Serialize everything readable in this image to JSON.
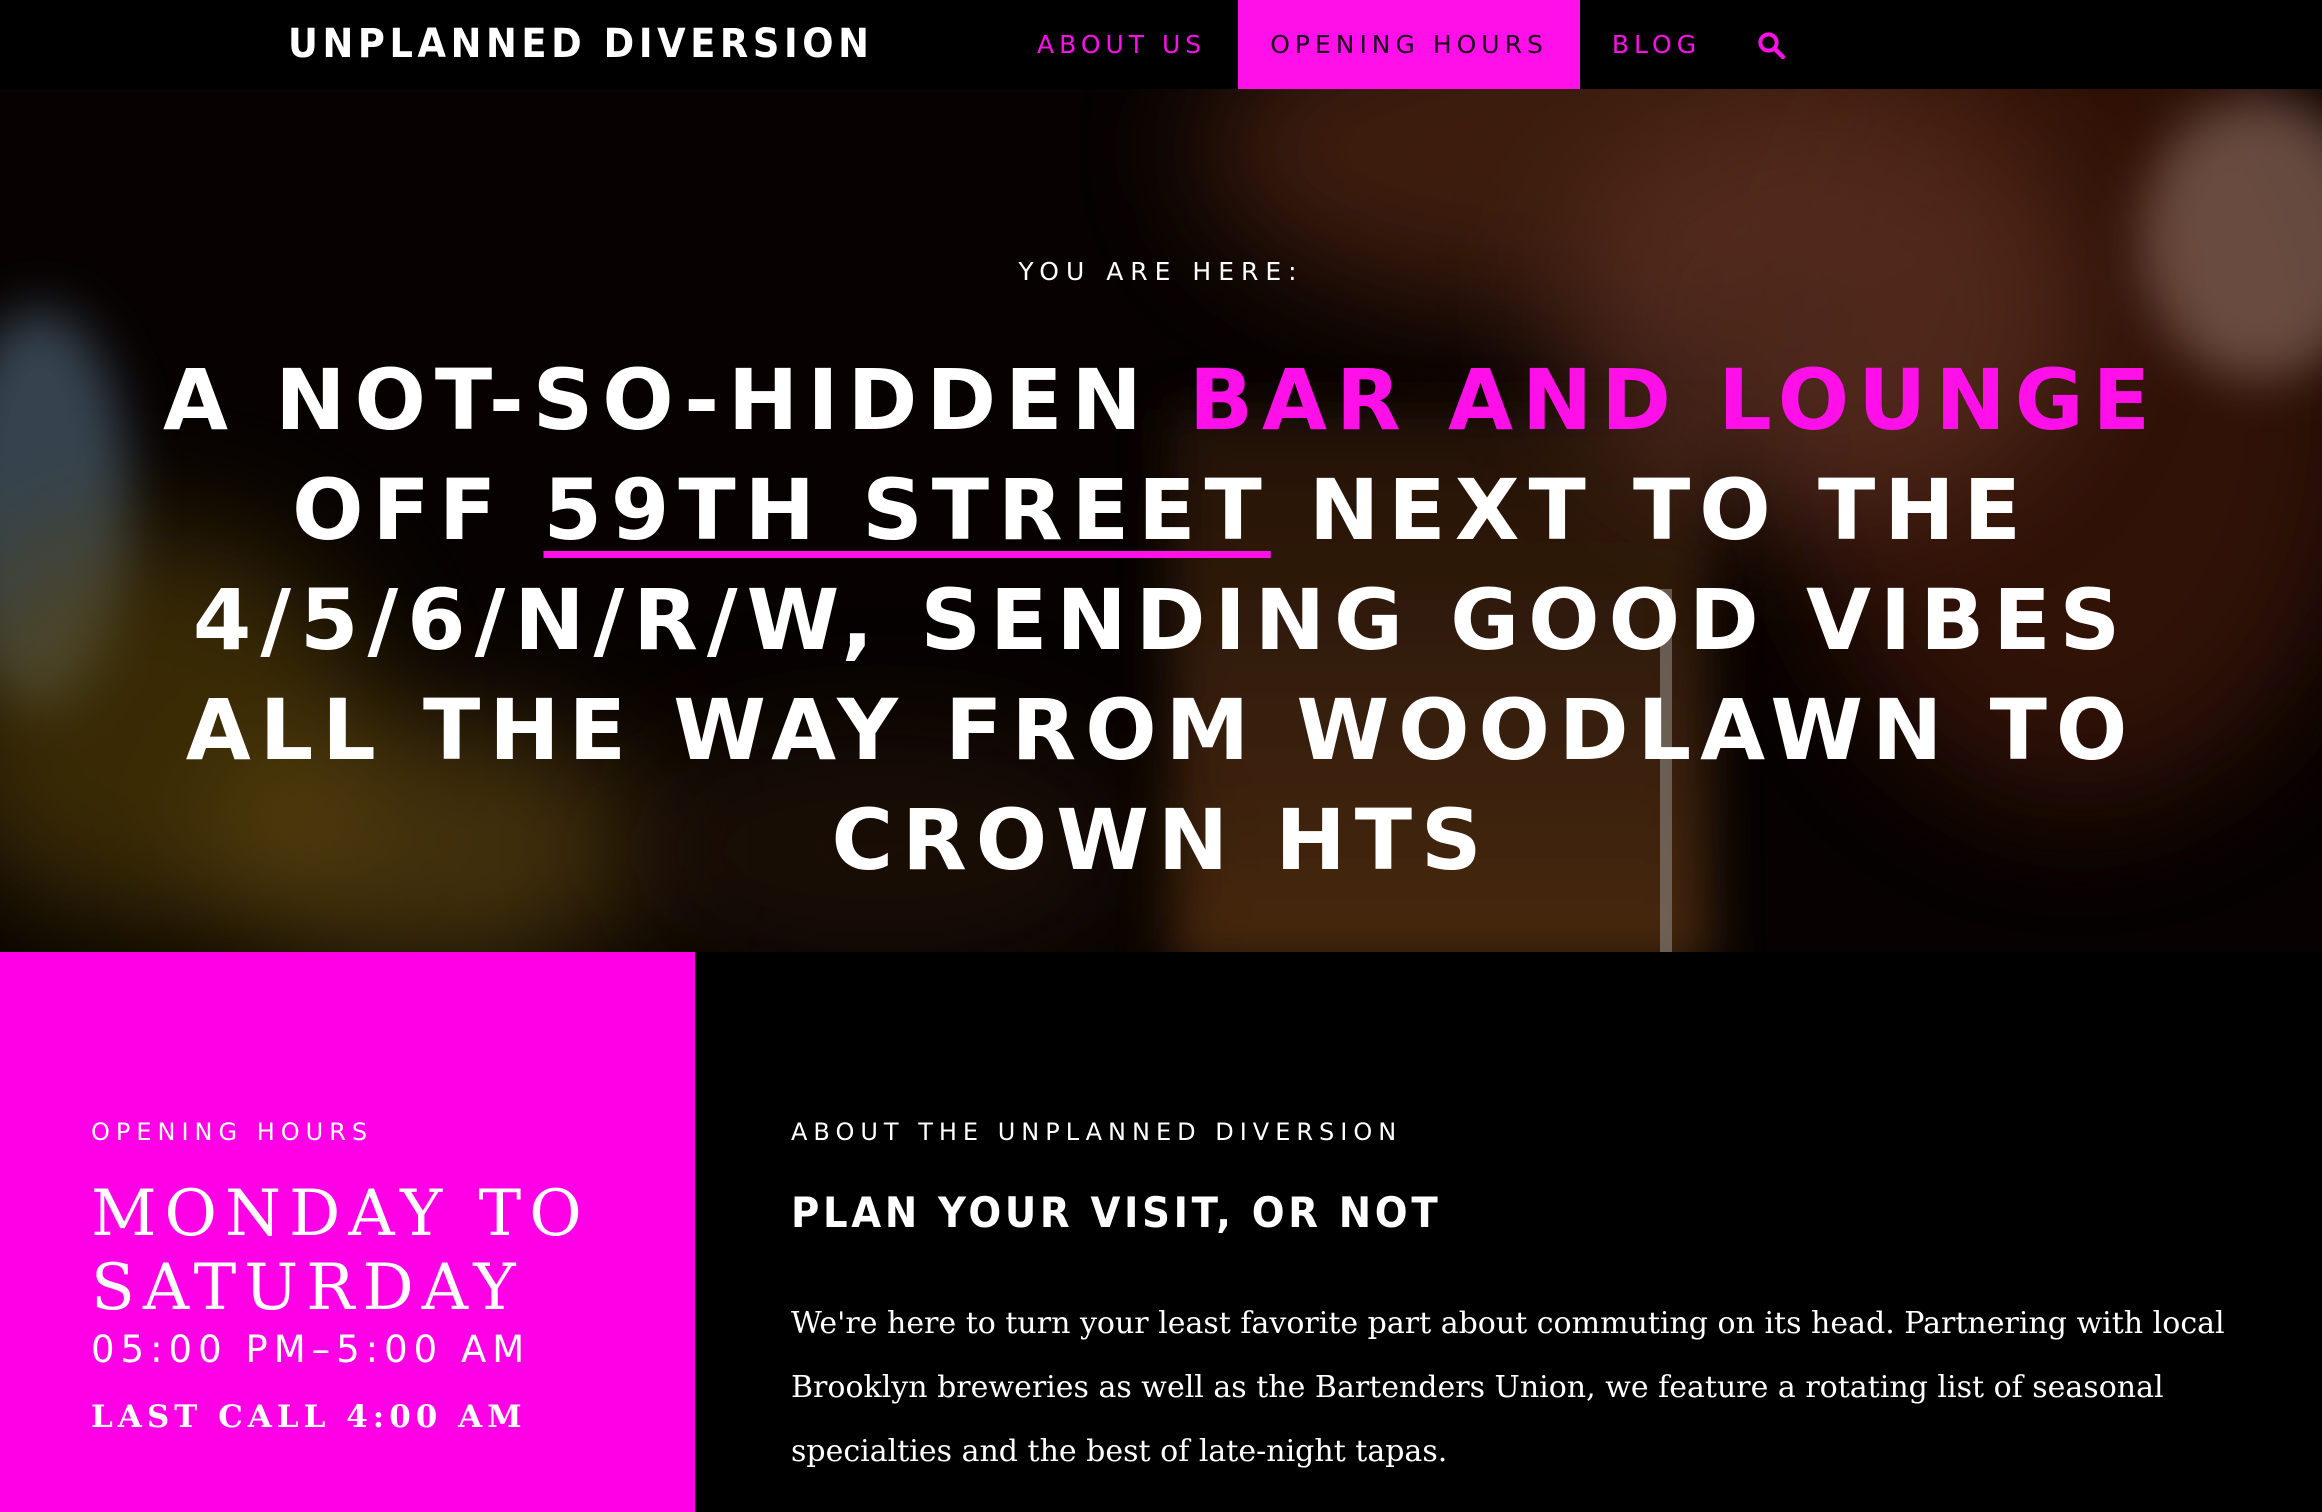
{
  "nav": {
    "brand": "UNPLANNED DIVERSION",
    "links": [
      {
        "label": "ABOUT US",
        "active": false
      },
      {
        "label": "OPENING HOURS",
        "active": true
      },
      {
        "label": "BLOG",
        "active": false
      }
    ],
    "search_icon": "search-icon"
  },
  "hero": {
    "eyebrow": "YOU ARE HERE:",
    "headline": {
      "part1": "A not-so-hidden ",
      "highlight": "bar and lounge",
      "part2": " off ",
      "link": "59th Street",
      "part3": " next to the 4/5/6/N/R/W, sending good vibes all the way from Woodlawn to Crown Hts"
    }
  },
  "hours": {
    "label": "OPENING HOURS",
    "days": "Monday to Saturday",
    "time": "05:00 PM–5:00 AM",
    "last_call": "LAST CALL 4:00 AM"
  },
  "about": {
    "label": "ABOUT THE UNPLANNED DIVERSION",
    "title": "PLAN YOUR VISIT, OR NOT",
    "body": "We're here to turn your least favorite part about commuting on its head. Partnering with local Brooklyn breweries as well as the Bartenders Union, we feature a rotating list of seasonal specialties and the best of late-night tapas."
  },
  "colors": {
    "accent": "#ff10e8",
    "background": "#000000",
    "text": "#ffffff"
  }
}
